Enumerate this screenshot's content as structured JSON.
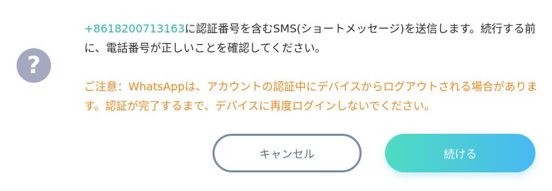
{
  "dialog": {
    "icon": "question-icon",
    "phone_number": "+8618200713163",
    "message_after_phone": "に認証番号を含むSMS(ショートメッセージ)を送信します。続行する前に、電話番号が正しいことを確認してください。",
    "warning": "ご注意：WhatsAppは、アカウントの認証中にデバイスからログアウトされる場合があります。認証が完了するまで、デバイスに再度ログインしないでください。",
    "cancel_label": "キャンセル",
    "continue_label": "続ける"
  },
  "colors": {
    "phone": "#2ab7b3",
    "warning": "#f08a24",
    "icon_bg": "#a5a9bf",
    "cancel_border": "#7b8aa8",
    "continue_gradient_start": "#4fdcc1",
    "continue_gradient_end": "#47b9f2"
  }
}
